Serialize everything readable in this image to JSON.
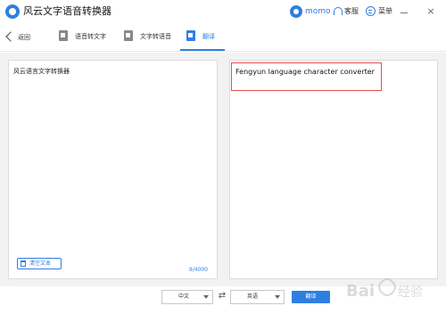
{
  "app": {
    "title": "风云文字语音转换器"
  },
  "titlebar": {
    "username": "momo",
    "service_label": "客服",
    "menu_label": "菜单",
    "minimize_glyph": "",
    "close_glyph": "×"
  },
  "toolbar": {
    "back_label": "返回",
    "tabs": [
      {
        "label": "语音转文字",
        "icon": "speech-to-text-icon",
        "active": false
      },
      {
        "label": "文字转语音",
        "icon": "text-to-speech-icon",
        "active": false
      },
      {
        "label": "翻译",
        "icon": "translate-icon",
        "active": true
      }
    ]
  },
  "source_panel": {
    "text": "风云语言文字转换器",
    "clear_label": "清空文本",
    "char_count": "9/4000"
  },
  "target_panel": {
    "text": "Fengyun language character converter"
  },
  "bottom_bar": {
    "source_lang": "中文",
    "target_lang": "英语",
    "swap_glyph": "⇄",
    "translate_label": "翻译"
  },
  "colors": {
    "accent": "#2f7fe0",
    "highlight_border": "#e05050"
  },
  "watermark": {
    "text": "Bai 经验"
  }
}
